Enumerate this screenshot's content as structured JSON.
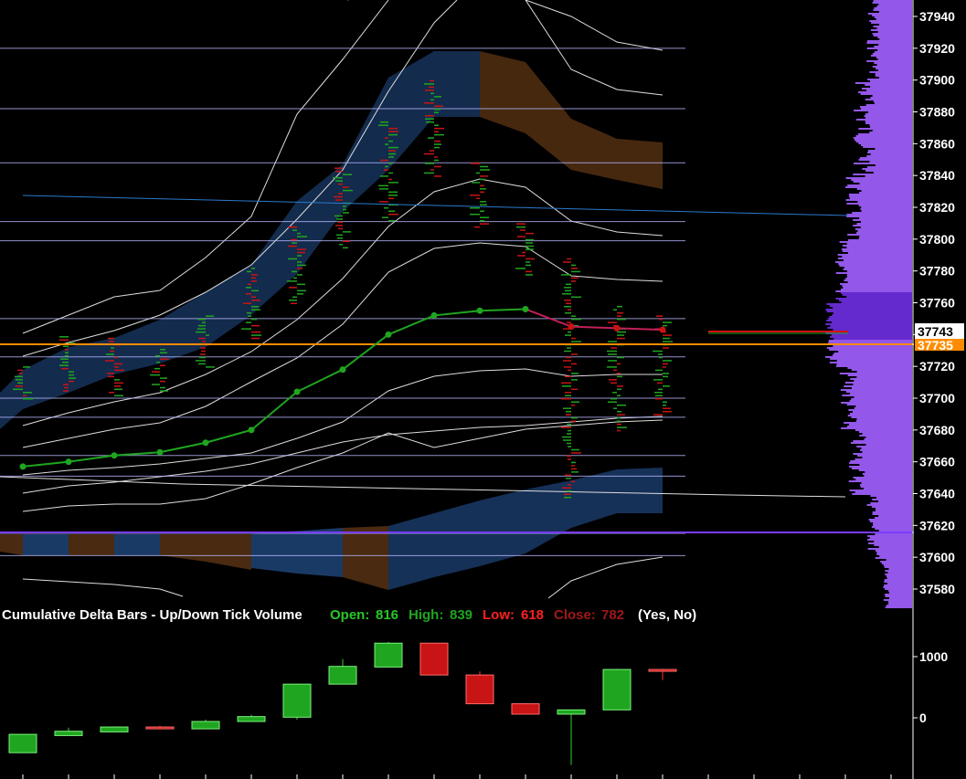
{
  "colors": {
    "background": "#000000",
    "grid_line": "#b8b8ff",
    "band_blue": "#1a3a66",
    "band_brown": "#4a2a10",
    "envelope": "#ffffff",
    "ma_line": "#1fa51f",
    "ma_line_late": "#c0205a",
    "profile": "#9b5cf5",
    "profile_poc": "#6a2cd8",
    "trend_line": "#2a7acb",
    "support_line": "#7a3cff",
    "current_line": "#ff8c00",
    "up": "#1fa51f",
    "down": "#c81414"
  },
  "chart_data": [
    {
      "type": "line",
      "title": "",
      "ylim": [
        37570,
        37950
      ],
      "y_ticks": [
        37940,
        37920,
        37900,
        37880,
        37860,
        37840,
        37820,
        37800,
        37780,
        37760,
        37740,
        37720,
        37700,
        37680,
        37660,
        37640,
        37620,
        37600,
        37580
      ],
      "price_marker_last": {
        "value": 37743,
        "label": "37743"
      },
      "price_marker_current": {
        "value": 37735,
        "label": "37735"
      },
      "horizontal_levels": [
        37920,
        37882,
        37848,
        37811,
        37799,
        37750,
        37726,
        37700,
        37688,
        37664,
        37651,
        37615,
        37601
      ],
      "series": [
        {
          "x": [
            1,
            2,
            3,
            4,
            5,
            6,
            7,
            8,
            9,
            10,
            11,
            12,
            13,
            14,
            15
          ],
          "values": [
            37657,
            37660,
            37664,
            37666,
            37672,
            37680,
            37704,
            37718,
            37740,
            37752,
            37755,
            37756,
            37745,
            37744,
            37743
          ]
        }
      ]
    },
    {
      "type": "bar",
      "title": "Cumulative Delta Bars - Up/Down Tick Volume",
      "y_ticks": [
        1000,
        0
      ],
      "ylim": [
        -800,
        1450
      ],
      "legend": {
        "open_label": "Open:",
        "open": "816",
        "high_label": "High:",
        "high": "839",
        "low_label": "Low:",
        "low": "618",
        "close_label": "Close:",
        "close": "782",
        "params": "(Yes, No)"
      },
      "candles": [
        {
          "open": -570,
          "high": -270,
          "low": -570,
          "close": -270
        },
        {
          "open": -290,
          "high": -160,
          "low": -290,
          "close": -220
        },
        {
          "open": -230,
          "high": -140,
          "low": -230,
          "close": -150
        },
        {
          "open": -150,
          "high": -130,
          "low": -190,
          "close": -180
        },
        {
          "open": -180,
          "high": -30,
          "low": -180,
          "close": -60
        },
        {
          "open": -60,
          "high": 50,
          "low": -60,
          "close": 20
        },
        {
          "open": 10,
          "high": 560,
          "low": -30,
          "close": 550
        },
        {
          "open": 550,
          "high": 960,
          "low": 550,
          "close": 840
        },
        {
          "open": 830,
          "high": 1240,
          "low": 830,
          "close": 1220
        },
        {
          "open": 1220,
          "high": 1220,
          "low": 700,
          "close": 700
        },
        {
          "open": 700,
          "high": 760,
          "low": 230,
          "close": 230
        },
        {
          "open": 230,
          "high": 240,
          "low": 60,
          "close": 60
        },
        {
          "open": 60,
          "high": 130,
          "low": -770,
          "close": 130
        },
        {
          "open": 130,
          "high": 800,
          "low": 130,
          "close": 790
        },
        {
          "open": 790,
          "high": 800,
          "low": 618,
          "close": 782
        }
      ]
    }
  ]
}
